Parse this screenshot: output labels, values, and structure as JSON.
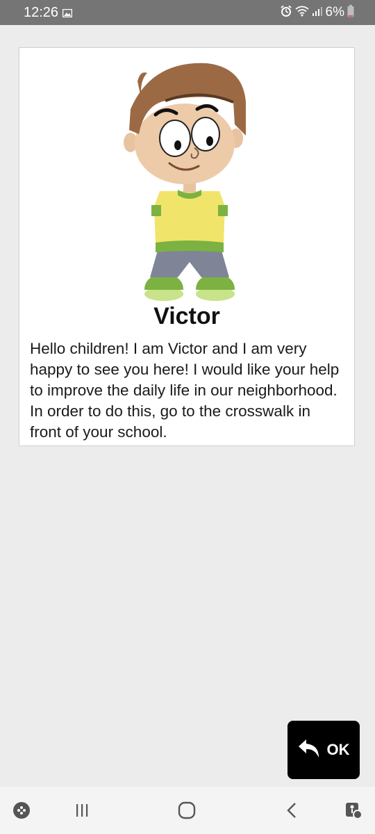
{
  "status_bar": {
    "time": "12:26",
    "battery": "6%",
    "icons": [
      "gallery-icon",
      "alarm-icon",
      "wifi-icon",
      "signal-icon",
      "battery-icon"
    ]
  },
  "card": {
    "character_name": "Victor",
    "message": "Hello children! I am Victor and I am very happy to see you here! I would like your help to improve the daily life in our neighborhood. In order to do this, go to the crosswalk in front of your school."
  },
  "ok_button": {
    "label": "OK",
    "icon": "reply-arrow-icon"
  },
  "nav_bar": {
    "items": [
      "game-launcher-icon",
      "recent-apps-icon",
      "home-icon",
      "back-icon",
      "accessibility-icon"
    ]
  },
  "colors": {
    "status_bar": "#757575",
    "background": "#ececec",
    "card": "#ffffff",
    "ok_button": "#000000",
    "nav_bar": "#f4f4f4"
  }
}
